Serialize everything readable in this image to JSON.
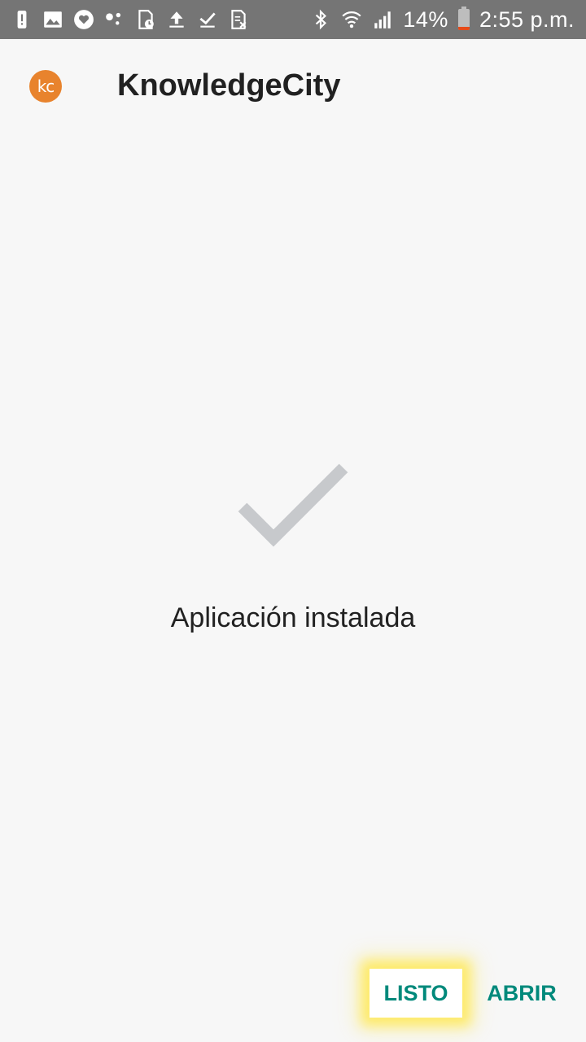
{
  "status_bar": {
    "left_icons": [
      "alert-icon",
      "image-icon",
      "heart-icon",
      "dots-icon",
      "sim-clock-icon",
      "upload-icon",
      "check-download-icon",
      "sim-x-icon"
    ],
    "right_icons": [
      "bluetooth-icon",
      "wifi-icon",
      "signal-icon"
    ],
    "battery_percent": "14%",
    "time": "2:55 p.m."
  },
  "app": {
    "logo_text": "kc",
    "title": "KnowledgeCity",
    "logo_color": "#e8832d"
  },
  "main": {
    "status_text": "Aplicación instalada",
    "check_color": "#c7c9cc"
  },
  "actions": {
    "done_label": "LISTO",
    "open_label": "ABRIR",
    "accent_color": "#00897b"
  }
}
